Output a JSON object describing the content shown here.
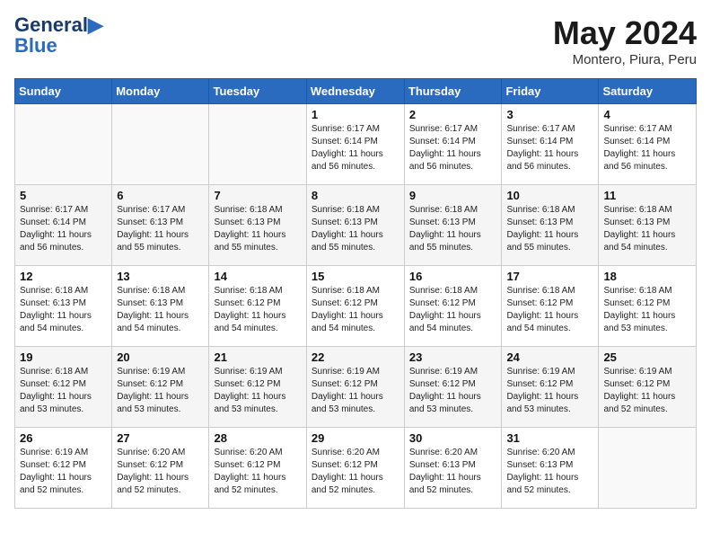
{
  "logo": {
    "part1": "General",
    "part2": "Blue"
  },
  "title": "May 2024",
  "location": "Montero, Piura, Peru",
  "weekdays": [
    "Sunday",
    "Monday",
    "Tuesday",
    "Wednesday",
    "Thursday",
    "Friday",
    "Saturday"
  ],
  "weeks": [
    [
      {
        "day": "",
        "sunrise": "",
        "sunset": "",
        "daylight": ""
      },
      {
        "day": "",
        "sunrise": "",
        "sunset": "",
        "daylight": ""
      },
      {
        "day": "",
        "sunrise": "",
        "sunset": "",
        "daylight": ""
      },
      {
        "day": "1",
        "sunrise": "6:17 AM",
        "sunset": "6:14 PM",
        "daylight": "11 hours and 56 minutes."
      },
      {
        "day": "2",
        "sunrise": "6:17 AM",
        "sunset": "6:14 PM",
        "daylight": "11 hours and 56 minutes."
      },
      {
        "day": "3",
        "sunrise": "6:17 AM",
        "sunset": "6:14 PM",
        "daylight": "11 hours and 56 minutes."
      },
      {
        "day": "4",
        "sunrise": "6:17 AM",
        "sunset": "6:14 PM",
        "daylight": "11 hours and 56 minutes."
      }
    ],
    [
      {
        "day": "5",
        "sunrise": "6:17 AM",
        "sunset": "6:14 PM",
        "daylight": "11 hours and 56 minutes."
      },
      {
        "day": "6",
        "sunrise": "6:17 AM",
        "sunset": "6:13 PM",
        "daylight": "11 hours and 55 minutes."
      },
      {
        "day": "7",
        "sunrise": "6:18 AM",
        "sunset": "6:13 PM",
        "daylight": "11 hours and 55 minutes."
      },
      {
        "day": "8",
        "sunrise": "6:18 AM",
        "sunset": "6:13 PM",
        "daylight": "11 hours and 55 minutes."
      },
      {
        "day": "9",
        "sunrise": "6:18 AM",
        "sunset": "6:13 PM",
        "daylight": "11 hours and 55 minutes."
      },
      {
        "day": "10",
        "sunrise": "6:18 AM",
        "sunset": "6:13 PM",
        "daylight": "11 hours and 55 minutes."
      },
      {
        "day": "11",
        "sunrise": "6:18 AM",
        "sunset": "6:13 PM",
        "daylight": "11 hours and 54 minutes."
      }
    ],
    [
      {
        "day": "12",
        "sunrise": "6:18 AM",
        "sunset": "6:13 PM",
        "daylight": "11 hours and 54 minutes."
      },
      {
        "day": "13",
        "sunrise": "6:18 AM",
        "sunset": "6:13 PM",
        "daylight": "11 hours and 54 minutes."
      },
      {
        "day": "14",
        "sunrise": "6:18 AM",
        "sunset": "6:12 PM",
        "daylight": "11 hours and 54 minutes."
      },
      {
        "day": "15",
        "sunrise": "6:18 AM",
        "sunset": "6:12 PM",
        "daylight": "11 hours and 54 minutes."
      },
      {
        "day": "16",
        "sunrise": "6:18 AM",
        "sunset": "6:12 PM",
        "daylight": "11 hours and 54 minutes."
      },
      {
        "day": "17",
        "sunrise": "6:18 AM",
        "sunset": "6:12 PM",
        "daylight": "11 hours and 54 minutes."
      },
      {
        "day": "18",
        "sunrise": "6:18 AM",
        "sunset": "6:12 PM",
        "daylight": "11 hours and 53 minutes."
      }
    ],
    [
      {
        "day": "19",
        "sunrise": "6:18 AM",
        "sunset": "6:12 PM",
        "daylight": "11 hours and 53 minutes."
      },
      {
        "day": "20",
        "sunrise": "6:19 AM",
        "sunset": "6:12 PM",
        "daylight": "11 hours and 53 minutes."
      },
      {
        "day": "21",
        "sunrise": "6:19 AM",
        "sunset": "6:12 PM",
        "daylight": "11 hours and 53 minutes."
      },
      {
        "day": "22",
        "sunrise": "6:19 AM",
        "sunset": "6:12 PM",
        "daylight": "11 hours and 53 minutes."
      },
      {
        "day": "23",
        "sunrise": "6:19 AM",
        "sunset": "6:12 PM",
        "daylight": "11 hours and 53 minutes."
      },
      {
        "day": "24",
        "sunrise": "6:19 AM",
        "sunset": "6:12 PM",
        "daylight": "11 hours and 53 minutes."
      },
      {
        "day": "25",
        "sunrise": "6:19 AM",
        "sunset": "6:12 PM",
        "daylight": "11 hours and 52 minutes."
      }
    ],
    [
      {
        "day": "26",
        "sunrise": "6:19 AM",
        "sunset": "6:12 PM",
        "daylight": "11 hours and 52 minutes."
      },
      {
        "day": "27",
        "sunrise": "6:20 AM",
        "sunset": "6:12 PM",
        "daylight": "11 hours and 52 minutes."
      },
      {
        "day": "28",
        "sunrise": "6:20 AM",
        "sunset": "6:12 PM",
        "daylight": "11 hours and 52 minutes."
      },
      {
        "day": "29",
        "sunrise": "6:20 AM",
        "sunset": "6:12 PM",
        "daylight": "11 hours and 52 minutes."
      },
      {
        "day": "30",
        "sunrise": "6:20 AM",
        "sunset": "6:13 PM",
        "daylight": "11 hours and 52 minutes."
      },
      {
        "day": "31",
        "sunrise": "6:20 AM",
        "sunset": "6:13 PM",
        "daylight": "11 hours and 52 minutes."
      },
      {
        "day": "",
        "sunrise": "",
        "sunset": "",
        "daylight": ""
      }
    ]
  ]
}
